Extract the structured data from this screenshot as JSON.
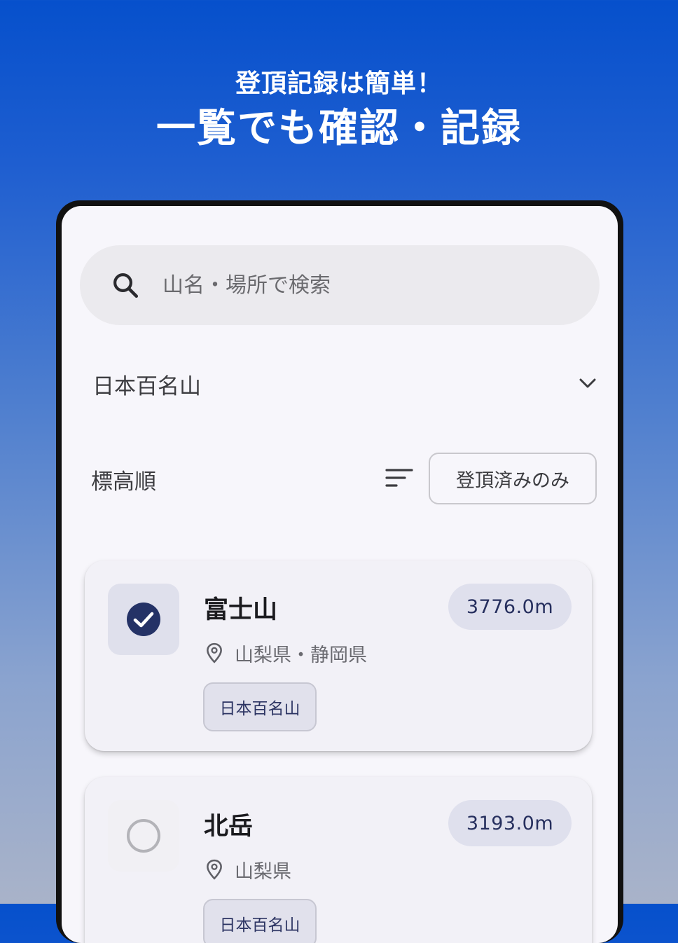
{
  "promo": {
    "subtitle": "登頂記録は簡単！",
    "title": "一覧でも確認・記録"
  },
  "search": {
    "placeholder": "山名・場所で検索",
    "value": ""
  },
  "category_select": {
    "selected": "日本百名山"
  },
  "sort": {
    "label": "標高順"
  },
  "filter": {
    "label": "登頂済みのみ"
  },
  "mountains": [
    {
      "name": "富士山",
      "location": "山梨県・静岡県",
      "tag": "日本百名山",
      "elevation": "3776.0m",
      "climbed": true
    },
    {
      "name": "北岳",
      "location": "山梨県",
      "tag": "日本百名山",
      "elevation": "3193.0m",
      "climbed": false
    }
  ],
  "colors": {
    "accent": "#243266",
    "background_top": "#0650cc",
    "background_bottom": "#a9b3c9",
    "screen": "#f7f6fb"
  },
  "icons": {
    "search": "search-icon",
    "chevron": "chevron-down-icon",
    "sort": "sort-icon",
    "pin": "location-pin-icon",
    "check": "check-circle-icon",
    "unchecked": "empty-circle-icon"
  }
}
